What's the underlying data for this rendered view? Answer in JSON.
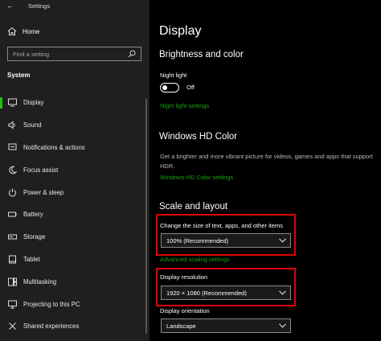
{
  "window": {
    "title": "Settings"
  },
  "sidebar": {
    "home_label": "Home",
    "search_placeholder": "Find a setting",
    "section_label": "System",
    "items": [
      {
        "label": "Display",
        "icon": "monitor-icon",
        "active": true
      },
      {
        "label": "Sound",
        "icon": "speaker-icon"
      },
      {
        "label": "Notifications & actions",
        "icon": "notification-icon"
      },
      {
        "label": "Focus assist",
        "icon": "moon-icon"
      },
      {
        "label": "Power & sleep",
        "icon": "power-icon"
      },
      {
        "label": "Battery",
        "icon": "battery-icon"
      },
      {
        "label": "Storage",
        "icon": "storage-icon"
      },
      {
        "label": "Tablet",
        "icon": "tablet-icon"
      },
      {
        "label": "Multitasking",
        "icon": "multitasking-icon"
      },
      {
        "label": "Projecting to this PC",
        "icon": "projector-icon"
      },
      {
        "label": "Shared experiences",
        "icon": "shared-experiences-icon"
      }
    ]
  },
  "main": {
    "title": "Display",
    "brightness": {
      "heading": "Brightness and color",
      "night_light_label": "Night light",
      "night_light_state": "Off",
      "night_light_link": "Night light settings"
    },
    "hd_color": {
      "heading": "Windows HD Color",
      "description": "Get a brighter and more vibrant picture for videos, games and apps that support HDR.",
      "link": "Windows HD Color settings"
    },
    "scale": {
      "heading": "Scale and layout",
      "size_label": "Change the size of text, apps, and other items",
      "size_value": "100% (Recommended)",
      "advanced_link": "Advanced scaling settings",
      "resolution_label": "Display resolution",
      "resolution_value": "1920 × 1080 (Recommended)",
      "orientation_label": "Display orientation",
      "orientation_value": "Landscape"
    }
  },
  "colors": {
    "accent": "#16c60c",
    "link": "#16a30c",
    "highlight": "#e00000",
    "sidebar_bg": "#1f1f1f",
    "content_bg": "#000000"
  }
}
